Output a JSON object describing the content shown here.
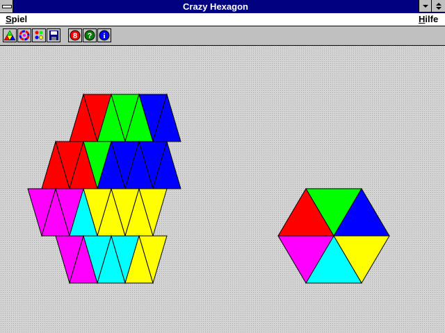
{
  "window": {
    "title": "Crazy Hexagon"
  },
  "menu": {
    "spiel_first": "S",
    "spiel_rest": "piel",
    "hilfe_first": "H",
    "hilfe_rest": "ilfe"
  },
  "toolbar": {
    "items": [
      {
        "name": "new-game",
        "icon": "colored-triangles-icon"
      },
      {
        "name": "shuffle",
        "icon": "color-swirl-icon"
      },
      {
        "name": "players",
        "icon": "figures-icon"
      },
      {
        "name": "save",
        "icon": "floppy-disk-icon"
      },
      {
        "name": "stop",
        "icon": "red-circle-icon",
        "glyph": "8"
      },
      {
        "name": "help",
        "icon": "green-question-icon",
        "glyph": "?"
      },
      {
        "name": "info",
        "icon": "blue-info-icon",
        "glyph": "i"
      }
    ]
  },
  "colors": {
    "red": "#ff0000",
    "green": "#00ff00",
    "blue": "#0000ff",
    "yellow": "#ffff00",
    "cyan": "#00ffff",
    "magenta": "#ff00ff",
    "titlebar": "#000080",
    "workspace": "#c0c0c0"
  },
  "game": {
    "board_grid": [
      [
        "red",
        "red",
        "green",
        "green",
        "green",
        "blue",
        "blue"
      ],
      [
        "red",
        "red",
        "red",
        "green",
        "blue",
        "blue",
        "blue",
        "blue",
        "blue"
      ],
      [
        "magenta",
        "magenta",
        "magenta",
        "cyan",
        "yellow",
        "yellow",
        "yellow",
        "yellow",
        "yellow"
      ],
      [
        "magenta",
        "magenta",
        "cyan",
        "cyan",
        "cyan",
        "yellow",
        "yellow"
      ]
    ],
    "target_sectors": [
      "green",
      "blue",
      "yellow",
      "cyan",
      "magenta",
      "red"
    ]
  }
}
